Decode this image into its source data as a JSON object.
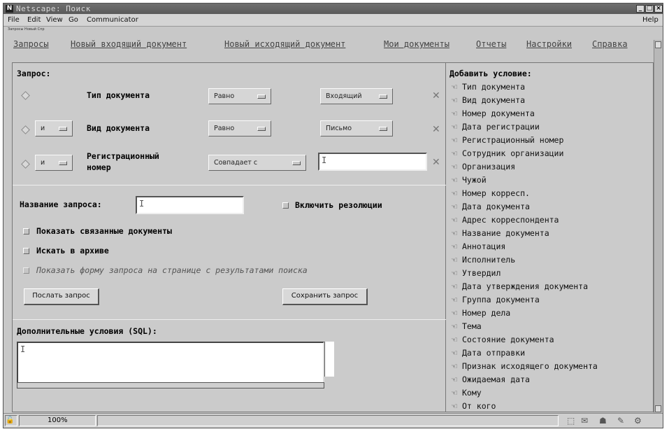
{
  "window": {
    "title": "Netscape: Поиск",
    "logo_letter": "N",
    "minimize_icon": "minimize-icon",
    "maximize_icon": "maximize-icon",
    "close_icon": "close-icon"
  },
  "menubar": {
    "items": [
      "File",
      "Edit",
      "View",
      "Go",
      "Communicator"
    ],
    "help": "Help"
  },
  "toolbar_tiny": "Запросы Новый Спр",
  "nav": {
    "links": [
      "Запросы",
      "Новый входящий документ",
      "Новый исходящий документ",
      "Мои документы",
      "Отчеты",
      "Настройки",
      "Справка"
    ]
  },
  "query": {
    "heading": "Запрос:",
    "rows": [
      {
        "connector": "",
        "field": "Тип документа",
        "operator": "Равно",
        "value": "Входящий",
        "value_type": "select"
      },
      {
        "connector": "и",
        "field": "Вид документа",
        "operator": "Равно",
        "value": "Письмо",
        "value_type": "select"
      },
      {
        "connector": "и",
        "field_line1": "Регистрационный",
        "field_line2": "номер",
        "operator": "Совпадает с",
        "value": "",
        "value_type": "text"
      }
    ]
  },
  "query_name": {
    "label": "Название запроса:",
    "value": "",
    "include_resolutions": "Включить резолюции"
  },
  "options": {
    "show_linked": "Показать связанные документы",
    "search_archive": "Искать в архиве",
    "show_form": "Показать форму запроса на странице с результатами поиска"
  },
  "buttons": {
    "send": "Послать запрос",
    "save": "Сохранить запрос"
  },
  "sql": {
    "label": "Дополнительные условия (SQL):",
    "value": ""
  },
  "add_condition": {
    "heading": "Добавить условие:",
    "items": [
      "Тип документа",
      "Вид документа",
      "Номер документа",
      "Дата регистрации",
      "Регистрационный номер",
      "Сотрудник организации",
      "Организация",
      "Чужой",
      "Номер корресп.",
      "Дата документа",
      "Адрес корреспондента",
      "Название документа",
      "Аннотация",
      "Исполнитель",
      "Утвердил",
      "Дата утверждения документа",
      "Группа документа",
      "Номер дела",
      "Тема",
      "Состояние документа",
      "Дата отправки",
      "Признак исходящего документа",
      "Ожидаемая дата",
      "Кому",
      "От кого"
    ]
  },
  "status": {
    "zoom": "100%"
  }
}
